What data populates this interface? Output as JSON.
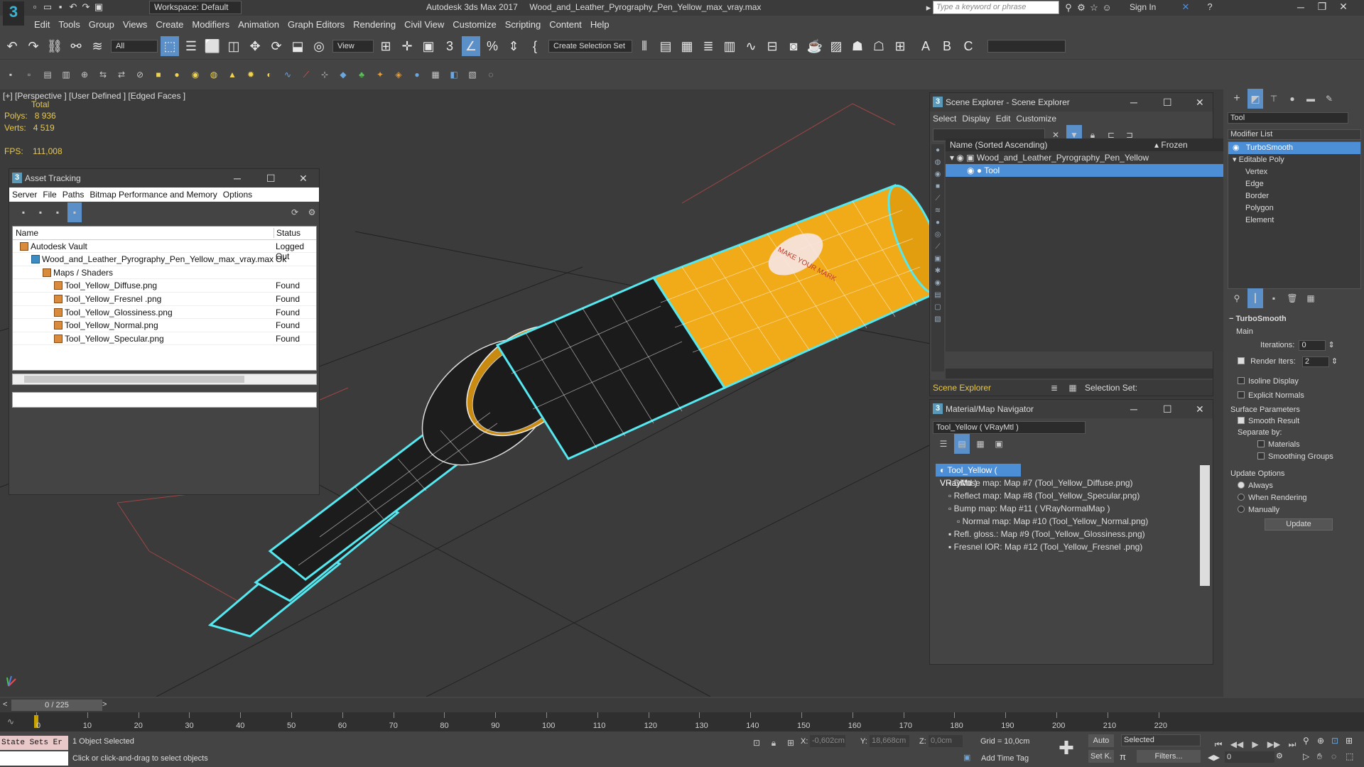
{
  "title": {
    "workspace": "Workspace: Default",
    "app": "Autodesk 3ds Max 2017",
    "file": "Wood_and_Leather_Pyrography_Pen_Yellow_max_vray.max",
    "search_placeholder": "Type a keyword or phrase",
    "signin": "Sign In"
  },
  "menu": [
    "Edit",
    "Tools",
    "Group",
    "Views",
    "Create",
    "Modifiers",
    "Animation",
    "Graph Editors",
    "Rendering",
    "Civil View",
    "Customize",
    "Scripting",
    "Content",
    "Help"
  ],
  "toolbar": {
    "filter": "All",
    "refcoord": "View",
    "selection_set": "Create Selection Set"
  },
  "viewport": {
    "label": "[+] [Perspective ]  [User Defined ]  [Edged Faces ]",
    "total_label": "Total",
    "polys_label": "Polys:",
    "polys_value": "8 936",
    "verts_label": "Verts:",
    "verts_value": "4 519",
    "fps_label": "FPS:",
    "fps_value": "111,008",
    "decal_text": "MAKE YOUR MARK"
  },
  "asset_tracking": {
    "title": "Asset Tracking",
    "menu": [
      "Server",
      "File",
      "Paths",
      "Bitmap Performance and Memory",
      "Options"
    ],
    "col_name": "Name",
    "col_status": "Status",
    "rows": [
      {
        "name": "Autodesk Vault",
        "status": "Logged Out"
      },
      {
        "name": "Wood_and_Leather_Pyrography_Pen_Yellow_max_vray.max",
        "status": "Ok"
      },
      {
        "name": "Maps / Shaders",
        "status": ""
      },
      {
        "name": "Tool_Yellow_Diffuse.png",
        "status": "Found"
      },
      {
        "name": "Tool_Yellow_Fresnel .png",
        "status": "Found"
      },
      {
        "name": "Tool_Yellow_Glossiness.png",
        "status": "Found"
      },
      {
        "name": "Tool_Yellow_Normal.png",
        "status": "Found"
      },
      {
        "name": "Tool_Yellow_Specular.png",
        "status": "Found"
      }
    ]
  },
  "scene_explorer": {
    "title": "Scene Explorer - Scene Explorer",
    "menu": [
      "Select",
      "Display",
      "Edit",
      "Customize"
    ],
    "col_name": "Name (Sorted Ascending)",
    "col_frozen": "▴ Frozen",
    "root": "Wood_and_Leather_Pyrography_Pen_Yellow",
    "child": "Tool",
    "footer_label": "Scene Explorer",
    "selection_set": "Selection Set:"
  },
  "material_nav": {
    "title": "Material/Map Navigator",
    "current": "Tool_Yellow  ( VRayMtl )",
    "items": [
      "Tool_Yellow  ( VRayMtl )",
      "Diffuse map: Map #7 (Tool_Yellow_Diffuse.png)",
      "Reflect map: Map #8 (Tool_Yellow_Specular.png)",
      "Bump map: Map #11  ( VRayNormalMap )",
      "Normal map: Map #10 (Tool_Yellow_Normal.png)",
      "Refl. gloss.: Map #9 (Tool_Yellow_Glossiness.png)",
      "Fresnel IOR: Map #12 (Tool_Yellow_Fresnel .png)"
    ]
  },
  "command_panel": {
    "object_name": "Tool",
    "modifier_list": "Modifier List",
    "stack": [
      "TurboSmooth",
      "Editable Poly",
      "Vertex",
      "Edge",
      "Border",
      "Polygon",
      "Element"
    ],
    "rollout_title": "TurboSmooth",
    "main_label": "Main",
    "iterations_label": "Iterations:",
    "iterations_value": "0",
    "render_iters_label": "Render Iters:",
    "render_iters_value": "2",
    "isoline": "Isoline Display",
    "explicit_normals": "Explicit Normals",
    "surface_params": "Surface Parameters",
    "smooth_result": "Smooth Result",
    "separate_by": "Separate by:",
    "materials": "Materials",
    "smoothing_groups": "Smoothing Groups",
    "update_options": "Update Options",
    "always": "Always",
    "when_rendering": "When Rendering",
    "manually": "Manually",
    "update_button": "Update"
  },
  "timeline": {
    "frame_counter": "0 / 225",
    "ticks": [
      "0",
      "10",
      "20",
      "30",
      "40",
      "50",
      "60",
      "70",
      "80",
      "90",
      "100",
      "110",
      "120",
      "130",
      "140",
      "150",
      "160",
      "170",
      "180",
      "190",
      "200",
      "210",
      "220"
    ]
  },
  "status": {
    "maxscript": "State Sets Er",
    "selected": "1 Object Selected",
    "hint": "Click or click-and-drag to select objects",
    "x_label": "X:",
    "x_value": "-0,602cm",
    "y_label": "Y:",
    "y_value": "18,668cm",
    "z_label": "Z:",
    "z_value": "0,0cm",
    "grid": "Grid = 10,0cm",
    "add_time_tag": "Add Time Tag",
    "auto": "Auto",
    "selected_dd": "Selected",
    "setk": "Set K.",
    "filters": "Filters...",
    "frame": "0"
  }
}
